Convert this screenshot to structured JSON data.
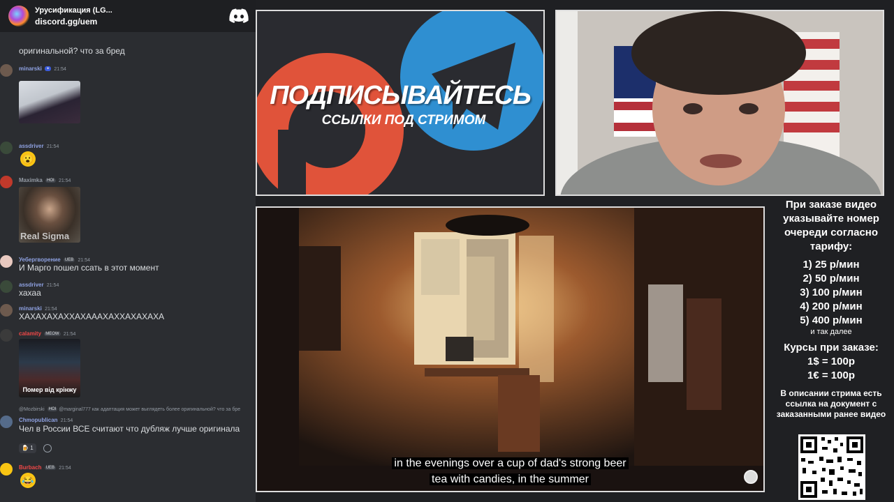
{
  "server": {
    "name": "Урусификация (LG...",
    "invite": "discord.gg/uem"
  },
  "chat": {
    "partial_top": "@marginal777 как адаптация может выглядеть более оригинальной? что за бред",
    "partial_top_line2": "оригинальной? что за бред",
    "messages": [
      {
        "user": "minarski",
        "time": "21:54",
        "attachment": "image"
      },
      {
        "user": "assdriver",
        "time": "21:54",
        "text": "😮"
      },
      {
        "user": "Maximka",
        "badge": "HOI",
        "time": "21:54",
        "attachment_caption": "Real Sigma"
      },
      {
        "user": "Уебергворение",
        "badge": "UEB",
        "time": "21:54",
        "text": "И Марго пошел ссать в этот момент"
      },
      {
        "user": "assdriver",
        "time": "21:54",
        "text": "хахаа"
      },
      {
        "user": "minarski",
        "time": "21:54",
        "text": "ХАХАХАХАХХАХАААХАХХАХАХАХА"
      },
      {
        "user": "calamity",
        "badge": "MEOW",
        "time": "21:54",
        "attachment_caption": "Помер від крінжу"
      },
      {
        "reply_user": "@Mozbirski",
        "reply_badge": "HOI",
        "reply_text": "@marginal777 как адаптация может выглядеть более оригинальной? что за бре",
        "user": "Chmopublican",
        "time": "21:54",
        "text": "Чел в России ВСЕ считают что дубляж лучше оригинала",
        "reaction_count": "1"
      },
      {
        "user": "Burbach",
        "badge": "UEB",
        "time": "21:54",
        "text": "😂"
      }
    ]
  },
  "promo": {
    "line1": "ПОДПИСЫВАЙТЕСЬ",
    "line2": "ССЫЛКИ ПОД СТРИМОМ"
  },
  "video": {
    "subtitle_line1": "in the evenings over a cup of dad's strong beer",
    "subtitle_line2": "tea with candies, in the summer"
  },
  "info": {
    "header": "При заказе видео указывайте номер очереди согласно тарифу:",
    "tariffs": [
      "1) 25 р/мин",
      "2) 50 р/мин",
      "3) 100 р/мин",
      "4) 200 р/мин",
      "5) 400 р/мин"
    ],
    "etc": "и так далее",
    "rates_title": "Курсы при заказе:",
    "rates": [
      "1$ = 100р",
      "1€ = 100р"
    ],
    "note": "В описании стрима есть ссылка на документ с заказанными ранее видео"
  },
  "colors": {
    "chat_bg": "#2b2d31",
    "page_bg": "#1f2023",
    "username_blue": "#8ea1e1",
    "username_red": "#f04747"
  }
}
